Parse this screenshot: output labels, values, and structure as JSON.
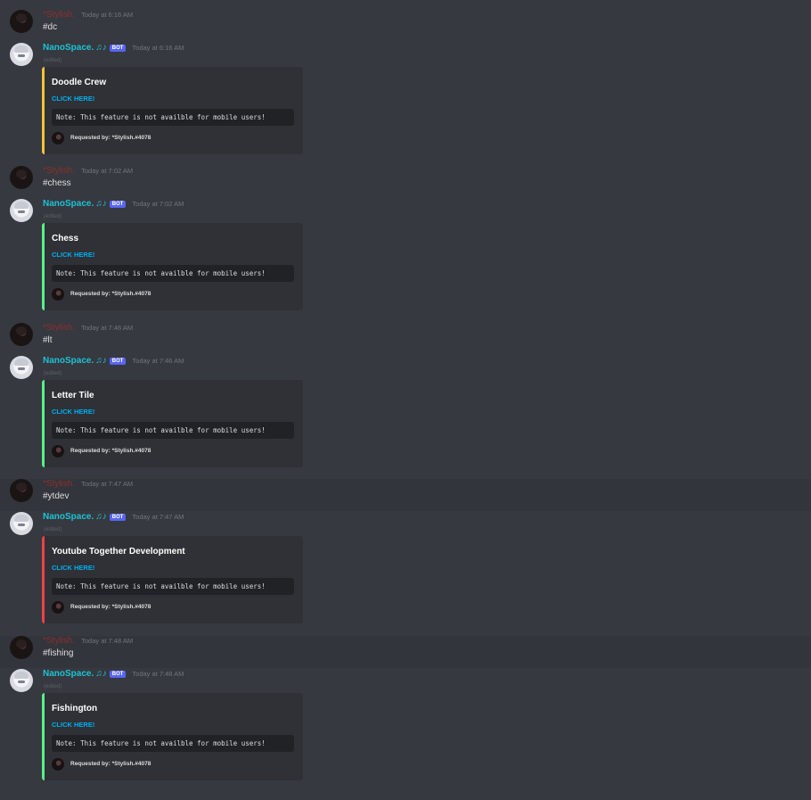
{
  "user": {
    "name": "*Stylish.",
    "avatar_icon": "user-avatar"
  },
  "bot": {
    "name": "NanoSpace.",
    "music_glyph": "♫♪",
    "tag": "BOT",
    "avatar_icon": "bot-avatar"
  },
  "edited_label": "(edited)",
  "embed_common": {
    "link_text": "CLICK HERE!",
    "note": "Note: This feature is not availble for mobile users!",
    "footer": "Requested by: *Stylish.#4078"
  },
  "conversations": [
    {
      "command": "#dc",
      "user_time": "Today at 6:16 AM",
      "bot_time": "Today at 6:16 AM",
      "embed_title": "Doodle Crew",
      "accent_color": "#f0c23b"
    },
    {
      "command": "#chess",
      "user_time": "Today at 7:02 AM",
      "bot_time": "Today at 7:02 AM",
      "embed_title": "Chess",
      "accent_color": "#57f287"
    },
    {
      "command": "#lt",
      "user_time": "Today at 7:46 AM",
      "bot_time": "Today at 7:46 AM",
      "embed_title": "Letter Tile",
      "accent_color": "#57f287"
    },
    {
      "command": "#ytdev",
      "user_time": "Today at 7:47 AM",
      "bot_time": "Today at 7:47 AM",
      "embed_title": "Youtube Together Development",
      "accent_color": "#ed4245"
    },
    {
      "command": "#fishing",
      "user_time": "Today at 7:48 AM",
      "bot_time": "Today at 7:48 AM",
      "embed_title": "Fishington",
      "accent_color": "#57f287"
    }
  ]
}
